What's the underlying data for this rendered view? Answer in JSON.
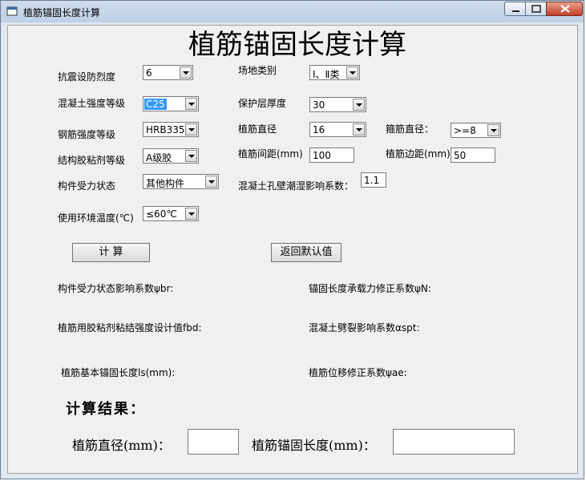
{
  "window": {
    "title": "植筋锚固长度计算"
  },
  "heading": "植筋锚固长度计算",
  "fields": {
    "seismic": {
      "label": "抗震设防烈度",
      "value": "6"
    },
    "site": {
      "label": "场地类别",
      "value": "Ⅰ、Ⅱ类"
    },
    "concrete": {
      "label": "混凝土强度等级",
      "value": "C25"
    },
    "cover": {
      "label": "保护层厚度",
      "value": "30"
    },
    "steel": {
      "label": "钢筋强度等级",
      "value": "HRB335"
    },
    "bar_diameter": {
      "label": "植筋直径",
      "value": "16"
    },
    "stirrup": {
      "label": "箍筋直径：",
      "value": ">=8"
    },
    "adhesive": {
      "label": "结构胶粘剂等级",
      "value": "A级胶"
    },
    "spacing": {
      "label": "植筋间距(mm)",
      "value": "100"
    },
    "edge": {
      "label": "植筋边距(mm)",
      "value": "50"
    },
    "member": {
      "label": "构件受力状态",
      "value": "其他构件"
    },
    "moisture": {
      "label": "混凝土孔壁潮湿影响系数：",
      "value": "1.1"
    },
    "temperature": {
      "label": "使用环境温度(℃)",
      "value": "≤60℃"
    }
  },
  "buttons": {
    "calculate": "计    算",
    "reset": "返回默认值"
  },
  "info": {
    "psi_br": "构件受力状态影响系数ψbr:",
    "psi_n": "锚固长度承载力修正系数ψN:",
    "fbd": "植筋用胶粘剂粘结强度设计值fbd:",
    "alpha_spt": "混凝土劈裂影响系数αspt:",
    "ls": "植筋基本锚固长度ls(mm):",
    "psi_ae": "植筋位移修正系数ψae:"
  },
  "result": {
    "title": "计算结果：",
    "diameter_label": "植筋直径(mm)：",
    "diameter_value": "",
    "length_label": "植筋锚固长度(mm)：",
    "length_value": ""
  },
  "icons": {
    "app": "window-app-icon",
    "minimize": "minimize-icon",
    "maximize": "maximize-icon",
    "close": "close-icon",
    "dropdown": "chevron-down-icon"
  }
}
